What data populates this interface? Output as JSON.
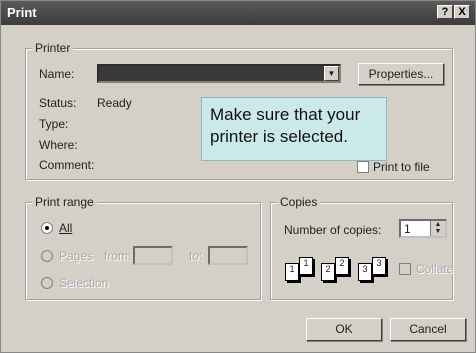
{
  "window": {
    "title": "Print",
    "help_button": "?",
    "close_button": "X"
  },
  "printer": {
    "group_label": "Printer",
    "name_label": "Name:",
    "properties_button": "Properties...",
    "status_label": "Status:",
    "status_value": "Ready",
    "type_label": "Type:",
    "where_label": "Where:",
    "comment_label": "Comment:",
    "print_to_file_label": "Print to file"
  },
  "callout": {
    "line1": "Make sure that your",
    "line2": "printer is selected."
  },
  "print_range": {
    "group_label": "Print range",
    "all_label": "All",
    "pages_label": "Pages",
    "from_label": "from:",
    "to_label": "to:",
    "selection_label": "Selection",
    "selected": "All"
  },
  "copies": {
    "group_label": "Copies",
    "number_label": "Number of copies:",
    "number_value": "1",
    "collate_label": "Collate",
    "page_labels": [
      "1",
      "1",
      "2",
      "2",
      "3",
      "3"
    ]
  },
  "buttons": {
    "ok": "OK",
    "cancel": "Cancel"
  }
}
